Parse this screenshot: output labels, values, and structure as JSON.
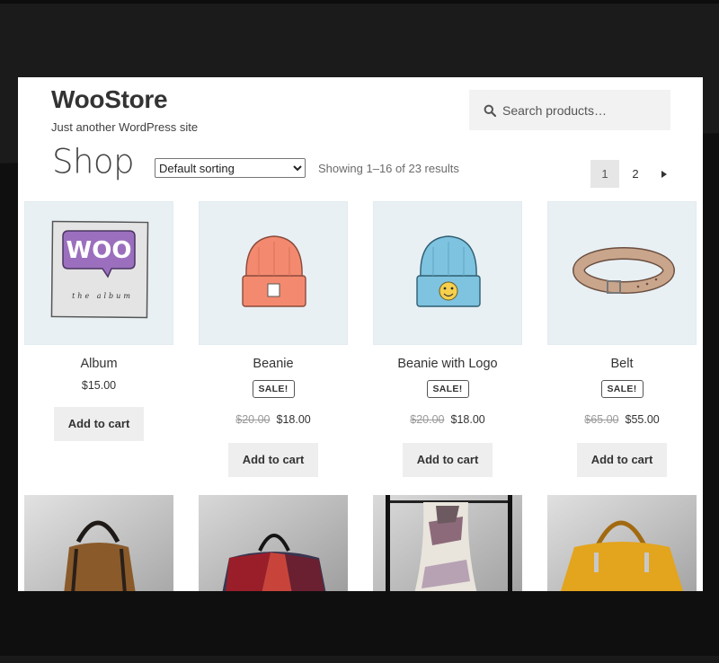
{
  "site": {
    "title": "WooStore",
    "tagline": "Just another WordPress site"
  },
  "search": {
    "placeholder": "Search products…"
  },
  "shop": {
    "title": "Shop",
    "sorting_selected": "Default sorting",
    "result_count": "Showing 1–16 of 23 results"
  },
  "pagination": {
    "current": "1",
    "page2": "2",
    "next_icon": "triangle-right-icon"
  },
  "products": [
    {
      "name": "Album",
      "price": "$15.00",
      "cart_label": "Add to cart",
      "icon": "woo-album-image"
    },
    {
      "name": "Beanie",
      "badge": "SALE!",
      "old_price": "$20.00",
      "price": "$18.00",
      "cart_label": "Add to cart",
      "icon": "orange-beanie-image"
    },
    {
      "name": "Beanie with Logo",
      "badge": "SALE!",
      "old_price": "$20.00",
      "price": "$18.00",
      "cart_label": "Add to cart",
      "icon": "blue-beanie-image"
    },
    {
      "name": "Belt",
      "badge": "SALE!",
      "old_price": "$65.00",
      "price": "$55.00",
      "cart_label": "Add to cart",
      "icon": "belt-image"
    }
  ],
  "photos": [
    "brown-bag-photo",
    "patchwork-bag-photo",
    "scarf-photo",
    "yellow-bag-photo"
  ],
  "album_art": {
    "logo": "WOO",
    "caption": "the album"
  },
  "colors": {
    "page_bg": "#1b1b1b",
    "card_bg": "#ffffff",
    "search_bg": "#f2f2f2",
    "button_bg": "#eeeeee",
    "thumb_bg": "#e8f0f4",
    "woo_purple": "#9b6fbe"
  }
}
